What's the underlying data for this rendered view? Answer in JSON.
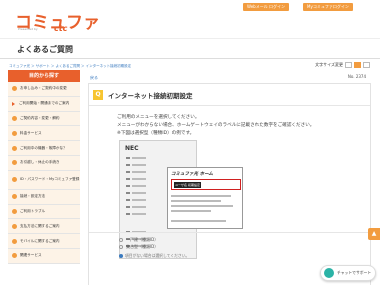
{
  "header": {
    "logo_text": "コミュファ",
    "logo_sub": "Presented by",
    "logo_brand": "ctc",
    "top_buttons": [
      "Webメール ログイン",
      "Myコミュファログイン"
    ]
  },
  "page_title": "よくあるご質問",
  "breadcrumb": "コミュファ光 ＞ サポート ＞ よくあるご質問 ＞ インターネット接続初期設定",
  "font_size": {
    "label": "文字サイズ変更",
    "options": [
      "小",
      "中",
      "大"
    ],
    "selected": 1
  },
  "sidebar": {
    "title": "目的から探す",
    "items": [
      {
        "label": "お申し込み・ご契約中の変更",
        "kind": "dot"
      },
      {
        "label": "ご利用開始・開通までのご案内",
        "kind": "arrow"
      },
      {
        "label": "ご契約内容・変更・解約",
        "kind": "dot"
      },
      {
        "label": "料金サービス",
        "kind": "dot"
      },
      {
        "label": "ご利用中の機器・故障かな？",
        "kind": "dot"
      },
      {
        "label": "お引越し・休止の手続き",
        "kind": "dot"
      },
      {
        "label": "ID・パスワード・Myコミュファ登録",
        "kind": "dot",
        "tall": true
      },
      {
        "label": "接続・設定方法",
        "kind": "dot"
      },
      {
        "label": "ご利用トラブル",
        "kind": "dot"
      },
      {
        "label": "支払方法に関するご案内",
        "kind": "dot"
      },
      {
        "label": "モバイルに関するご案内",
        "kind": "dot"
      },
      {
        "label": "関連サービス",
        "kind": "dot"
      }
    ]
  },
  "main": {
    "back_label": "戻る",
    "faq_no": "No. 2374",
    "q_badge": "Q",
    "q_title": "インターネット接続初期設定",
    "body_lines": [
      "ご利用のメニューを選択してください。",
      "メニューがわからない場合、ホームゲートウェイのラベルに記載された数字をご確認ください。",
      "※下図は選択型（種類ID）の例です。"
    ],
    "device_brand": "NEC",
    "sticker_title": "コミュファ光 ホーム",
    "sticker_label": "ユーザ名 初期設定",
    "options": [
      "一戸建（種類ID）",
      "集合型（種類ID）"
    ],
    "note": "項目がない場合は選択してください。"
  },
  "chat": {
    "label": "チャットでサポート"
  },
  "colors": {
    "brand": "#e8602c",
    "accent": "#f29c3f",
    "badge": "#f7c531",
    "link": "#3a7abf"
  }
}
